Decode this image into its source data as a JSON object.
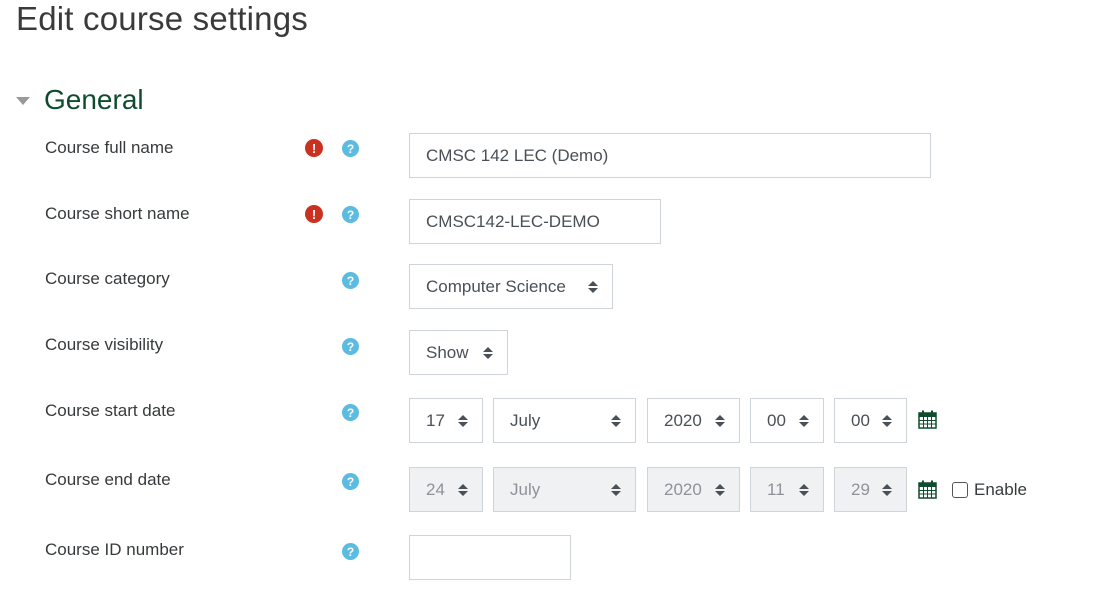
{
  "page": {
    "title": "Edit course settings"
  },
  "section": {
    "title": "General"
  },
  "fields": {
    "fullname": {
      "label": "Course full name",
      "value": "CMSC 142 LEC (Demo)",
      "required": true
    },
    "shortname": {
      "label": "Course short name",
      "value": "CMSC142-LEC-DEMO",
      "required": true
    },
    "category": {
      "label": "Course category",
      "value": "Computer Science"
    },
    "visibility": {
      "label": "Course visibility",
      "value": "Show"
    },
    "startdate": {
      "label": "Course start date",
      "day": "17",
      "month": "July",
      "year": "2020",
      "hour": "00",
      "minute": "00"
    },
    "enddate": {
      "label": "Course end date",
      "day": "24",
      "month": "July",
      "year": "2020",
      "hour": "11",
      "minute": "29",
      "enable_label": "Enable",
      "enabled": false
    },
    "idnumber": {
      "label": "Course ID number",
      "value": ""
    }
  },
  "icons": {
    "required": "!",
    "help": "?"
  },
  "colors": {
    "accent": "#0f4c2d",
    "required": "#ca3120",
    "help": "#5bbbe0"
  }
}
